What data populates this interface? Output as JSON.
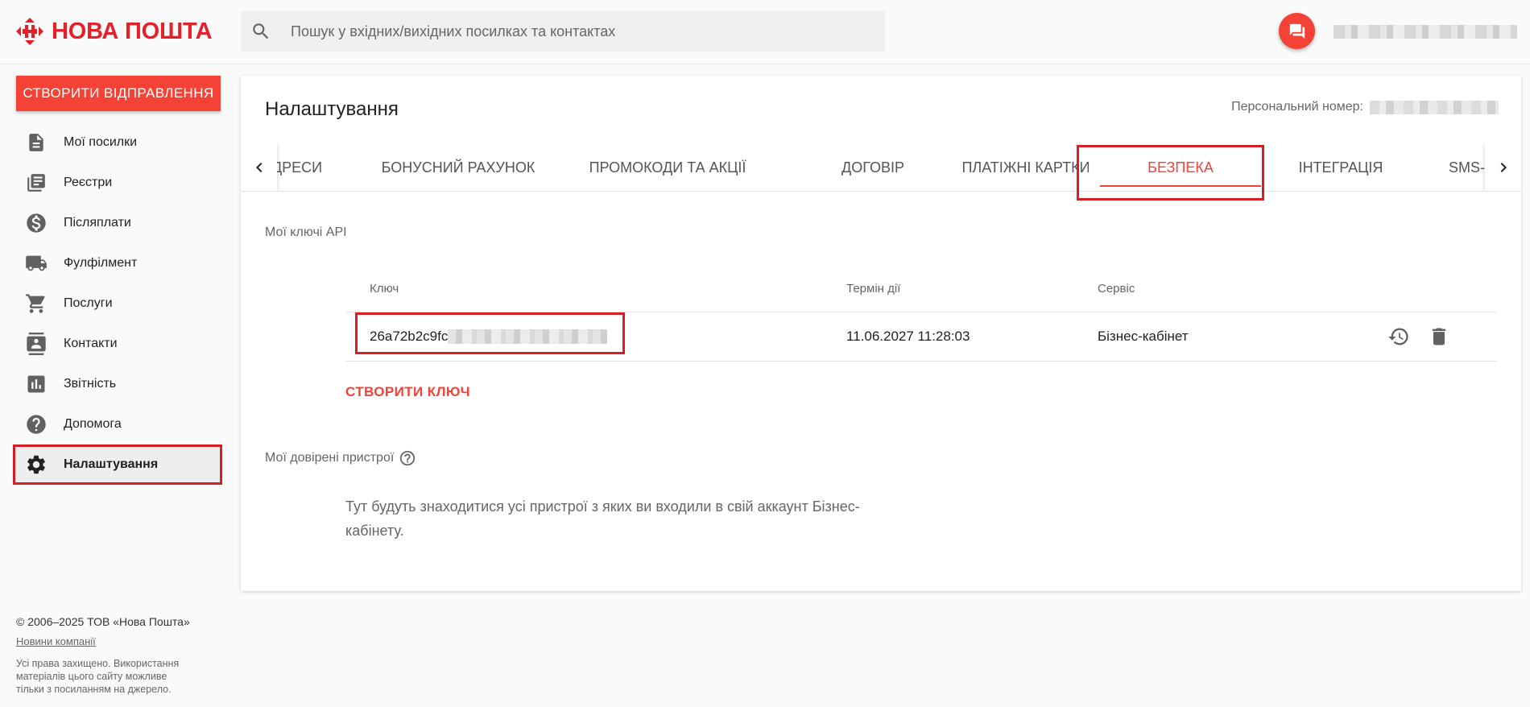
{
  "brand": {
    "logo_text": "НОВА ПОШТА",
    "color": "#e4202b"
  },
  "search": {
    "placeholder": "Пошук у вхідних/вихідних посилках та контактах"
  },
  "sidebar": {
    "create_button": "СТВОРИТИ ВІДПРАВЛЕННЯ",
    "items": [
      {
        "label": "Мої посилки",
        "icon": "document-icon"
      },
      {
        "label": "Реєстри",
        "icon": "registry-icon"
      },
      {
        "label": "Післяплати",
        "icon": "dollar-icon"
      },
      {
        "label": "Фулфілмент",
        "icon": "truck-icon"
      },
      {
        "label": "Послуги",
        "icon": "cart-icon"
      },
      {
        "label": "Контакти",
        "icon": "contacts-icon"
      },
      {
        "label": "Звітність",
        "icon": "chart-icon"
      },
      {
        "label": "Допомога",
        "icon": "help-icon"
      },
      {
        "label": "Налаштування",
        "icon": "gear-icon",
        "active": true
      }
    ]
  },
  "footer": {
    "copyright": "© 2006–2025 ТОВ «Нова Пошта»",
    "news_link": "Новини компанії",
    "rights_line1": "Усі права захищено. Використання",
    "rights_line2": "матеріалів цього сайту можливе",
    "rights_line3": "тільки з посиланням на джерело."
  },
  "main": {
    "title": "Налаштування",
    "personal_label": "Персональний номер:",
    "tabs": [
      {
        "label": "ДРЕСИ"
      },
      {
        "label": "БОНУСНИЙ РАХУНОК"
      },
      {
        "label": "ПРОМОКОДИ ТА АКЦІЇ"
      },
      {
        "label": "ДОГОВІР"
      },
      {
        "label": "ПЛАТІЖНІ КАРТКИ"
      },
      {
        "label": "БЕЗПЕКА",
        "active": true
      },
      {
        "label": "ІНТЕГРАЦІЯ"
      },
      {
        "label": "SMS-"
      }
    ],
    "api_section_label": "Мої ключі API",
    "table": {
      "headers": {
        "key": "Ключ",
        "term": "Термін дії",
        "service": "Сервіс"
      },
      "rows": [
        {
          "key_prefix": "26a72b2c9fc",
          "term": "11.06.2027 11:28:03",
          "service": "Бізнес-кабінет"
        }
      ]
    },
    "create_key_button": "СТВОРИТИ КЛЮЧ",
    "devices_label": "Мої довірені пристрої",
    "devices_text_line1": "Тут будуть знаходитися усі пристрої з яких ви входили в свій аккаунт Бізнес-",
    "devices_text_line2": "кабінету."
  },
  "colors": {
    "accent": "#f44336",
    "highlight": "#d32027"
  }
}
